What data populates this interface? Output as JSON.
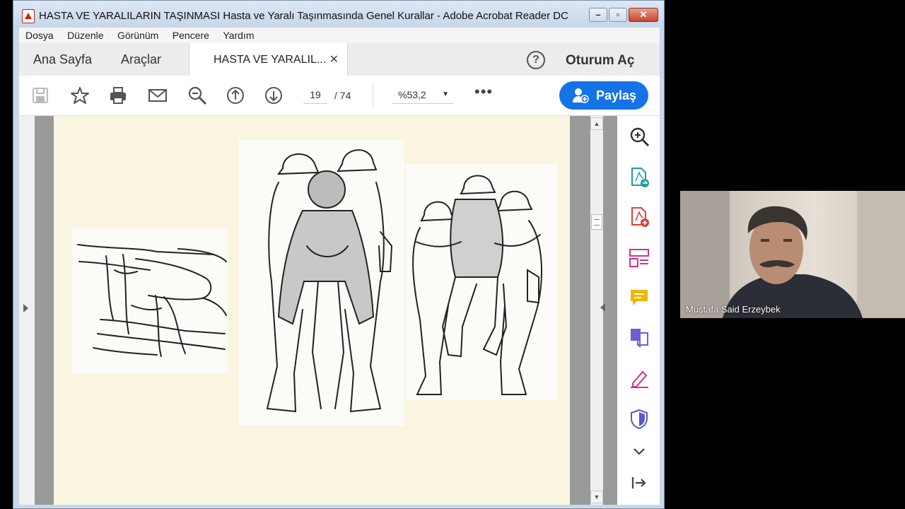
{
  "window": {
    "title": "HASTA VE YARALILARIN TAŞINMASI  Hasta ve Yaralı Taşınmasında Genel Kurallar  - Adobe Acrobat Reader DC"
  },
  "menu": [
    "Dosya",
    "Düzenle",
    "Görünüm",
    "Pencere",
    "Yardım"
  ],
  "tabs": {
    "home": "Ana Sayfa",
    "tools": "Araçlar",
    "document": "HASTA VE YARALIL...",
    "help": "?",
    "signin": "Oturum Aç"
  },
  "toolbar": {
    "current_page": "19",
    "total_pages": "/  74",
    "zoom": "%53,2",
    "more": "•••",
    "share_label": "Paylaş"
  },
  "icons": {
    "toolbar": [
      "save-icon",
      "star-icon",
      "print-icon",
      "mail-icon",
      "zoom-out-icon",
      "page-up-icon",
      "page-down-icon"
    ],
    "right_panel": [
      "zoom-search-icon",
      "export-pdf-icon",
      "create-pdf-icon",
      "organize-pages-icon",
      "comment-icon",
      "combine-files-icon",
      "fill-sign-icon",
      "protect-icon",
      "expand-tools-icon",
      "collapse-panel-icon"
    ]
  },
  "colors": {
    "accent": "#1473e6",
    "page_background": "#faf5e0"
  },
  "webcam": {
    "participant_name": "Mustafa Said Erzeybek"
  }
}
